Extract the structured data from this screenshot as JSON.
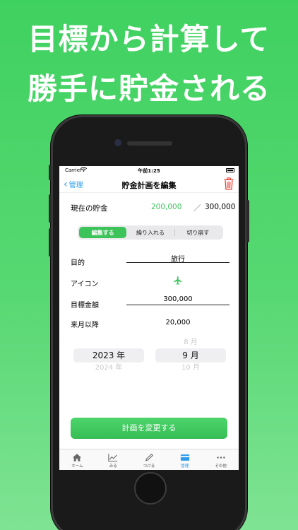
{
  "promo": {
    "line1": "目標から計算して",
    "line2": "勝手に貯金される"
  },
  "status_bar": {
    "carrier": "Carrier",
    "time": "午前1:25"
  },
  "nav": {
    "back_label": "管理",
    "title": "貯金計画を編集"
  },
  "savings": {
    "label": "現在の貯金",
    "current": "200,000",
    "separator": "／",
    "goal": "300,000"
  },
  "segments": [
    {
      "label": "編集する",
      "active": true
    },
    {
      "label": "繰り入れる",
      "active": false
    },
    {
      "label": "切り崩す",
      "active": false
    }
  ],
  "form": {
    "purpose_label": "目的",
    "purpose_value": "旅行",
    "icon_label": "アイコン",
    "icon_name": "airplane-icon",
    "target_label": "目標金額",
    "target_value": "300,000",
    "monthly_label": "来月以降",
    "monthly_value": "20,000"
  },
  "picker": {
    "year_selected": "2023 年",
    "year_next": "2024 年",
    "month_prev": "8 月",
    "month_selected": "9 月",
    "month_next": "10 月"
  },
  "cta_label": "計画を変更する",
  "tabs": [
    {
      "label": "ホーム",
      "icon": "home-icon",
      "active": false
    },
    {
      "label": "みる",
      "icon": "chart-icon",
      "active": false
    },
    {
      "label": "つける",
      "icon": "pencil-icon",
      "active": false
    },
    {
      "label": "管理",
      "icon": "card-icon",
      "active": true
    },
    {
      "label": "その他",
      "icon": "more-icon",
      "active": false
    }
  ],
  "colors": {
    "accent_green": "#3cc35a",
    "link_blue": "#2b9bea",
    "trash_red": "#e8463c"
  }
}
